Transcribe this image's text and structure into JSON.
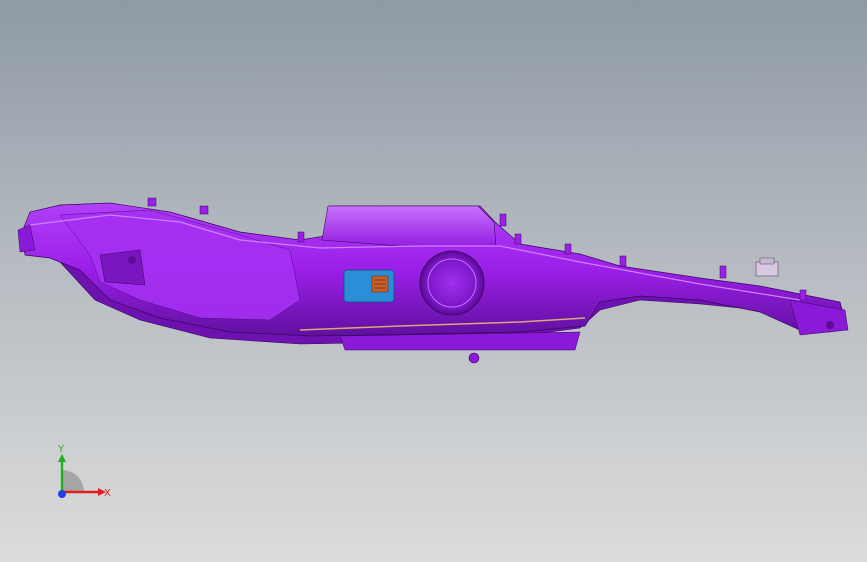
{
  "viewport": {
    "background_top": "#8f9aa6",
    "background_bottom": "#dcdcdc"
  },
  "model": {
    "body_color": "#9b1fe8",
    "shade_color": "#6d12b0",
    "highlight_color": "#c060ff",
    "connector_color": "#2a8fd6",
    "detail_color": "#c8602a"
  },
  "triad": {
    "x_label": "X",
    "y_label": "Y",
    "x_color": "#e02020",
    "y_color": "#20b020",
    "z_color": "#2040e0"
  }
}
